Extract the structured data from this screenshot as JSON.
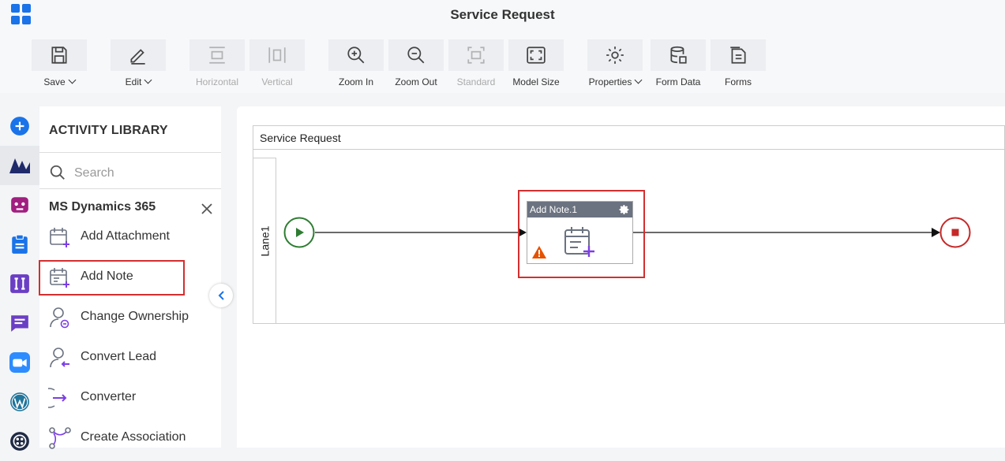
{
  "window": {
    "title": "Service Request"
  },
  "toolbar": {
    "items": [
      {
        "label": "Save",
        "icon": "save-icon",
        "dropdown": true,
        "enabled": true
      },
      {
        "label": "Edit",
        "icon": "edit-icon",
        "dropdown": true,
        "enabled": true
      },
      {
        "label": "Horizontal",
        "icon": "horizontal-icon",
        "enabled": false
      },
      {
        "label": "Vertical",
        "icon": "vertical-icon",
        "enabled": false
      },
      {
        "label": "Zoom In",
        "icon": "zoom-in-icon",
        "enabled": true
      },
      {
        "label": "Zoom Out",
        "icon": "zoom-out-icon",
        "enabled": true
      },
      {
        "label": "Standard",
        "icon": "standard-icon",
        "enabled": false
      },
      {
        "label": "Model Size",
        "icon": "model-size-icon",
        "enabled": true
      },
      {
        "label": "Properties",
        "icon": "gear-icon",
        "dropdown": true,
        "enabled": true
      },
      {
        "label": "Form Data",
        "icon": "database-icon",
        "enabled": true
      },
      {
        "label": "Forms",
        "icon": "forms-icon",
        "enabled": true
      }
    ]
  },
  "rail": {
    "items": [
      "add-icon",
      "dynamics-icon",
      "bot-icon",
      "clipboard-icon",
      "toggl-icon",
      "chat-icon",
      "zoom-video-icon",
      "wordpress-icon",
      "twilio-icon"
    ],
    "active": "dynamics-icon"
  },
  "library": {
    "title": "ACTIVITY LIBRARY",
    "search_placeholder": "Search",
    "group_title": "MS Dynamics 365",
    "items": [
      {
        "label": "Add Attachment",
        "icon": "add-attachment-icon"
      },
      {
        "label": "Add Note",
        "icon": "add-note-icon",
        "highlighted": true
      },
      {
        "label": "Change Ownership",
        "icon": "change-ownership-icon"
      },
      {
        "label": "Convert Lead",
        "icon": "convert-lead-icon"
      },
      {
        "label": "Converter",
        "icon": "converter-icon"
      },
      {
        "label": "Create Association",
        "icon": "create-association-icon"
      }
    ]
  },
  "canvas": {
    "pool_title": "Service Request",
    "lane_label": "Lane1",
    "node": {
      "title": "Add Note.1",
      "has_warning": true,
      "selected": true
    }
  },
  "colors": {
    "accent": "#1a73e8",
    "highlight": "#d32f2f",
    "start_event": "#2e7d32",
    "end_event": "#c62828",
    "node_header": "#6b7280",
    "warning": "#e65100",
    "icon_purple": "#7b3fe4"
  }
}
